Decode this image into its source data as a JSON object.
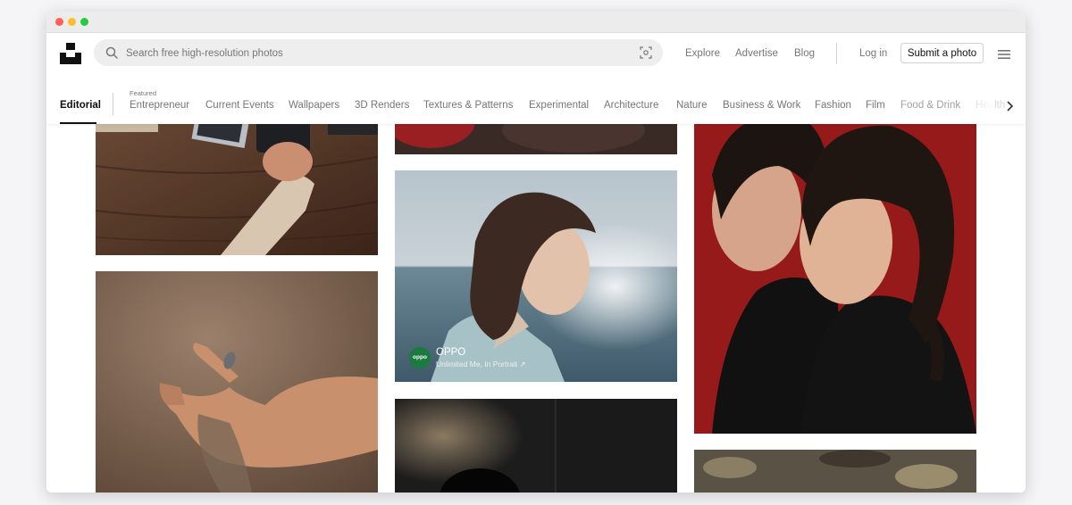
{
  "search": {
    "placeholder": "Search free high-resolution photos"
  },
  "nav": {
    "explore": "Explore",
    "advertise": "Advertise",
    "blog": "Blog",
    "login": "Log in",
    "submit": "Submit a photo"
  },
  "tabs": {
    "active": "Editorial",
    "featured_label": "Featured",
    "items": [
      "Entrepreneur",
      "Current Events",
      "Wallpapers",
      "3D Renders",
      "Textures & Patterns",
      "Experimental",
      "Architecture",
      "Nature",
      "Business & Work",
      "Fashion",
      "Film",
      "Food & Drink",
      "Health"
    ]
  },
  "sponsored": {
    "avatar_text": "oppo",
    "name": "OPPO",
    "tagline": "Unlimited Me, In Portrait ↗"
  },
  "icons": [
    "unsplash-logo-icon",
    "search-icon",
    "visual-search-icon",
    "hamburger-menu-icon",
    "chevron-right-icon"
  ],
  "colors": {
    "accent": "#111111",
    "muted": "#767676",
    "brand_green": "#1b7a3e"
  }
}
